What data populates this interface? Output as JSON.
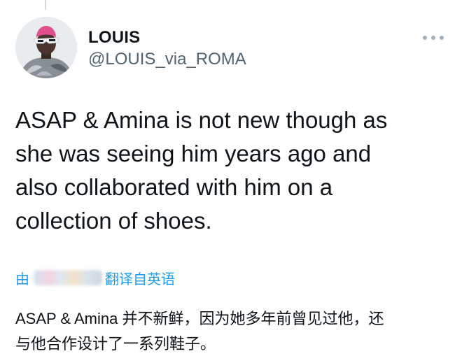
{
  "author": {
    "display_name": "LOUIS",
    "handle": "@LOUIS_via_ROMA"
  },
  "tweet": {
    "text": "ASAP & Amina is not new though as\nshe was seeing him years ago and\nalso collaborated with him on a\ncollection of shoes."
  },
  "translation": {
    "by_label": "由",
    "link_label": "翻译自英语",
    "text": "ASAP & Amina 并不新鲜，因为她多年前曾见过他，还\n与他合作设计了一系列鞋子。"
  },
  "icons": {
    "more": "more-horizontal-icon"
  },
  "colors": {
    "text_primary": "#0f1419",
    "text_secondary": "#536471",
    "accent": "#1d9bf0",
    "icon_gray": "#a5b1ba"
  }
}
